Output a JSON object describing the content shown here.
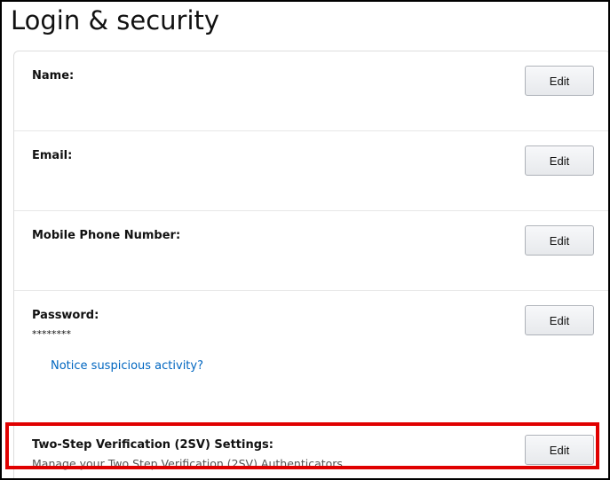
{
  "page": {
    "title": "Login & security",
    "highlight_color": "#e00000"
  },
  "rows": {
    "name": {
      "label": "Name:",
      "edit_label": "Edit"
    },
    "email": {
      "label": "Email:",
      "edit_label": "Edit"
    },
    "phone": {
      "label": "Mobile Phone Number:",
      "edit_label": "Edit"
    },
    "password": {
      "label": "Password:",
      "value": "********",
      "link": "Notice suspicious activity?",
      "edit_label": "Edit"
    },
    "two_step": {
      "label": "Two-Step Verification (2SV) Settings:",
      "description": "Manage your Two Step Verification (2SV) Authenticators",
      "edit_label": "Edit"
    }
  },
  "colors": {
    "link": "#0066c0",
    "text": "#111111",
    "subtext": "#555555"
  }
}
